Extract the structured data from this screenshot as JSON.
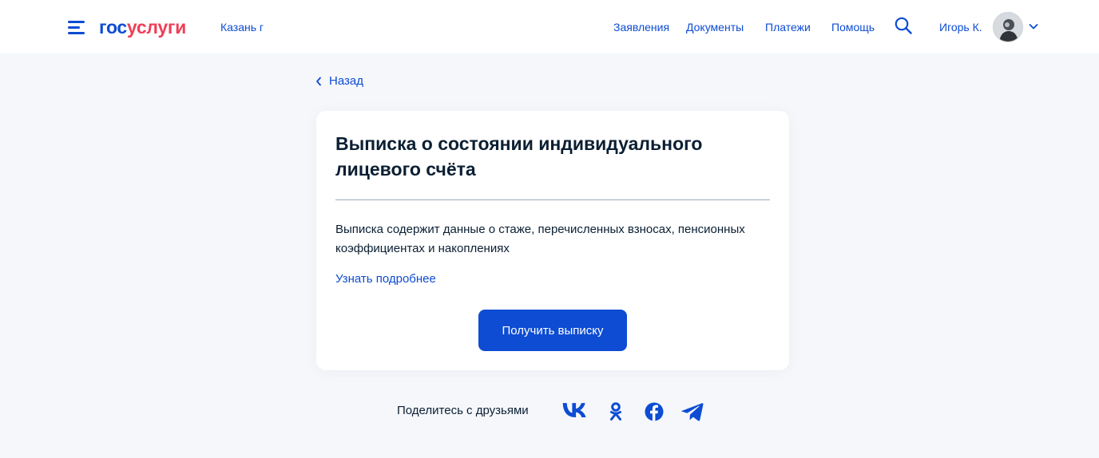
{
  "header": {
    "logo_part1": "гос",
    "logo_part2": "услуги",
    "city": "Казань г",
    "nav": [
      "Заявления",
      "Документы",
      "Платежи",
      "Помощь"
    ],
    "user_name": "Игорь К.",
    "icons": [
      "menu-icon",
      "search-icon",
      "avatar",
      "chevron-down-icon"
    ]
  },
  "back_label": "Назад",
  "card": {
    "title": "Выписка о состоянии индивидуального лицевого счёта",
    "description": "Выписка содержит данные о стаже, перечисленных взносах, пенсионных коэффициентах и накоплениях",
    "more_link": "Узнать подробнее",
    "button_label": "Получить выписку"
  },
  "share": {
    "label": "Поделитесь с друзьями",
    "networks": [
      "vk-icon",
      "odnoklassniki-icon",
      "facebook-icon",
      "telegram-icon"
    ]
  },
  "colors": {
    "brand_blue": "#0d4cd3",
    "brand_red": "#ee3f58",
    "background": "#f5f7fb",
    "text": "#0b1f33"
  }
}
